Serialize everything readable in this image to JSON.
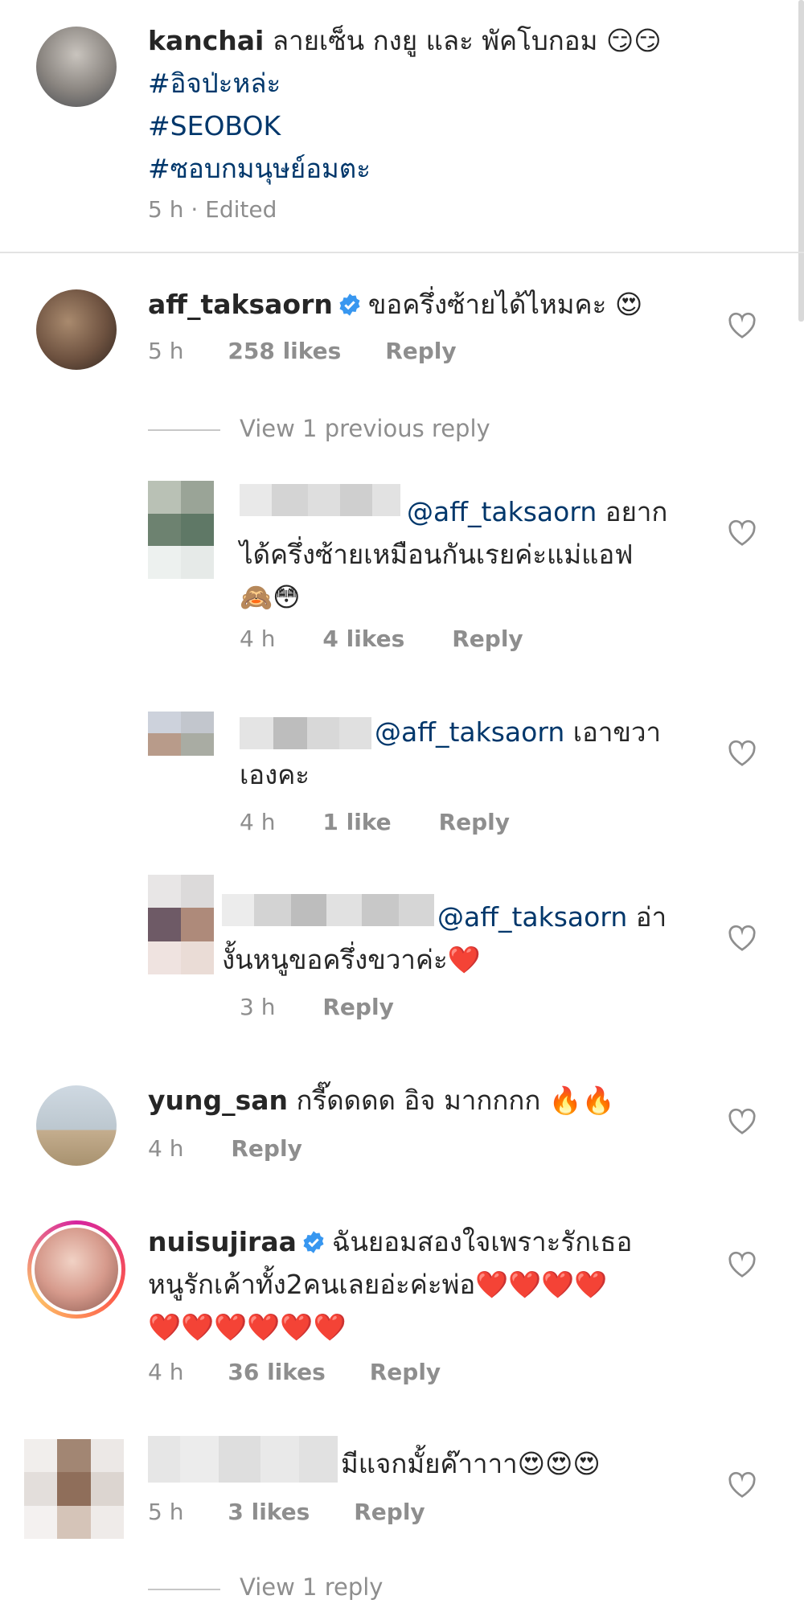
{
  "caption": {
    "username": "kanchai",
    "text": "ลายเซ็น กงยู และ พัคโบกอม 😏😏",
    "hashtags": [
      "#อิจป่ะหล่ะ",
      "#SEOBOK",
      "#ซอบกมนุษย์อมตะ"
    ],
    "meta": "5 h · Edited"
  },
  "comments": [
    {
      "username": "aff_taksaorn",
      "text": "ขอครึ่งซ้ายได้ไหมคะ 😍",
      "time": "5 h",
      "likes": "258 likes",
      "reply": "Reply"
    },
    {
      "mention": "@aff_taksaorn",
      "text_line1": "อยาก",
      "text_line2": "ได้ครึ่งซ้ายเหมือนกันเรยค่ะแม่แอฟ",
      "text_line3": "🙈😳",
      "time": "4 h",
      "likes": "4 likes",
      "reply": "Reply"
    },
    {
      "mention": "@aff_taksaorn",
      "text_line1": "เอาขวา",
      "text_line2": "เองคะ",
      "time": "4 h",
      "likes": "1 like",
      "reply": "Reply"
    },
    {
      "mention": "@aff_taksaorn",
      "text_line1": "อ่า",
      "text_line2": "งั้นหนูขอครึ่งขวาค่ะ❤️",
      "time": "3 h",
      "reply": "Reply"
    },
    {
      "username": "yung_san",
      "text": "กรี๊ดดดด  อิจ มากกกก 🔥🔥",
      "time": "4 h",
      "reply": "Reply"
    },
    {
      "username": "nuisujiraa",
      "text_line1": "ฉันยอมสองใจเพราะรักเธอ",
      "text_line2": "หนูรักเค้าทั้ง2คนเลยอ่ะค่ะพ่อ❤️❤️❤️❤️",
      "text_line3": "❤️❤️❤️❤️❤️❤️",
      "time": "4 h",
      "likes": "36 likes",
      "reply": "Reply"
    },
    {
      "text": "มีแจกมั้ยค๊าาาา😍😍😍",
      "time": "5 h",
      "likes": "3 likes",
      "reply": "Reply"
    }
  ],
  "view_previous": "View 1 previous reply",
  "view_reply": "View 1 reply",
  "colors": {
    "link": "#00376b",
    "meta": "#8e8e8e",
    "heart": "#ed4956",
    "verified": "#3897f0"
  }
}
